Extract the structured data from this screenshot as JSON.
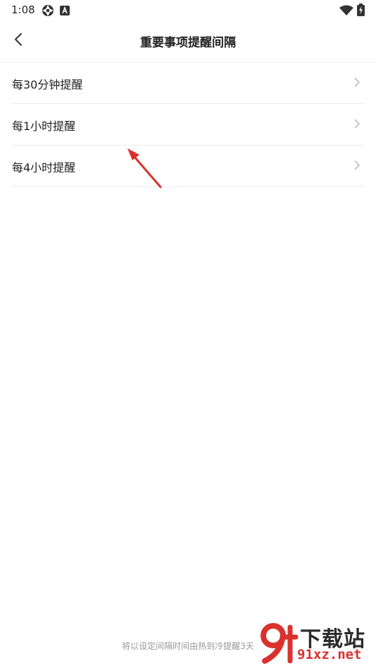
{
  "status_bar": {
    "time": "1:08",
    "icons": [
      "aperture-icon",
      "a-box-icon",
      "wifi-icon",
      "battery-charging-icon"
    ]
  },
  "app_bar": {
    "back_icon": "chevron-left-icon",
    "title": "重要事项提醒间隔"
  },
  "list": {
    "items": [
      {
        "label": "每30分钟提醒",
        "icon": "chevron-right-icon"
      },
      {
        "label": "每1小时提醒",
        "icon": "chevron-right-icon"
      },
      {
        "label": "每4小时提醒",
        "icon": "chevron-right-icon"
      }
    ]
  },
  "footer": {
    "note": "将以设定间隔时间由热到冷提醒3天"
  },
  "annotation": {
    "arrow_color": "#d9322e"
  },
  "watermark": {
    "title": "下载站",
    "url": "91xz.net",
    "logo_text": "9f",
    "brand_color": "#d9322e"
  }
}
